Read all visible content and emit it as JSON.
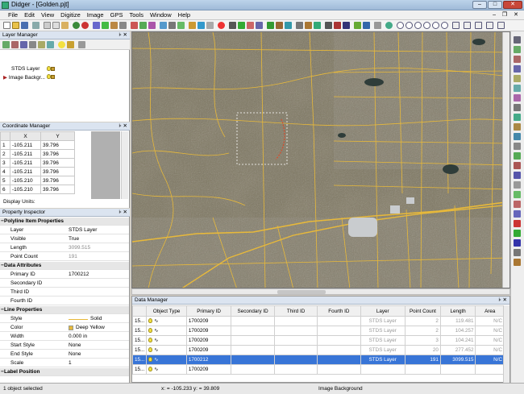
{
  "window": {
    "title": "Didger - [Golden.pjt]",
    "min": "–",
    "max": "□",
    "close": "✕"
  },
  "menu": [
    "File",
    "Edit",
    "View",
    "Digitize",
    "Image",
    "GPS",
    "Tools",
    "Window",
    "Help"
  ],
  "layer_manager": {
    "title": "Layer Manager",
    "layers": [
      {
        "name": "STDS Layer"
      },
      {
        "name": "Image Backgr..."
      }
    ]
  },
  "coordinate_manager": {
    "title": "Coordinate Manager",
    "headers": [
      "X",
      "Y"
    ],
    "rows": [
      [
        "1",
        "-105.211",
        "39.796"
      ],
      [
        "2",
        "-105.211",
        "39.796"
      ],
      [
        "3",
        "-105.211",
        "39.796"
      ],
      [
        "4",
        "-105.211",
        "39.796"
      ],
      [
        "5",
        "-105.210",
        "39.796"
      ],
      [
        "6",
        "-105.210",
        "39.796"
      ]
    ],
    "display_units": "Display Units:"
  },
  "property_inspector": {
    "title": "Property Inspector",
    "rows": [
      {
        "type": "section",
        "label": "Polyline Item Properties"
      },
      {
        "label": "Layer",
        "value": "STDS Layer"
      },
      {
        "label": "Visible",
        "value": "True"
      },
      {
        "label": "Length",
        "value": "3099.515",
        "grey": true
      },
      {
        "label": "Point Count",
        "value": "191",
        "grey": true
      },
      {
        "type": "section",
        "label": "Data Attributes"
      },
      {
        "label": "Primary ID",
        "value": "1700212"
      },
      {
        "label": "Secondary ID",
        "value": ""
      },
      {
        "label": "Third ID",
        "value": ""
      },
      {
        "label": "Fourth ID",
        "value": ""
      },
      {
        "type": "section",
        "label": "Line Properties"
      },
      {
        "label": "Style",
        "value": "Solid"
      },
      {
        "label": "Color",
        "value": "Deep Yellow"
      },
      {
        "label": "Width",
        "value": "0.000 in"
      },
      {
        "label": "Start Style",
        "value": "None"
      },
      {
        "label": "End Style",
        "value": "None"
      },
      {
        "label": "Scale",
        "value": "1"
      },
      {
        "type": "section",
        "label": "Label Position"
      }
    ]
  },
  "data_manager": {
    "title": "Data Manager",
    "headers": [
      "",
      "Object Type",
      "Primary ID",
      "Secondary ID",
      "Third ID",
      "Fourth ID",
      "Layer",
      "Point Count",
      "Length",
      "Area"
    ],
    "rows": [
      [
        "15...",
        "",
        "1700209",
        "",
        "",
        "",
        "STDS Layer",
        "2",
        "119.481",
        "N/C"
      ],
      [
        "15...",
        "",
        "1700209",
        "",
        "",
        "",
        "STDS Layer",
        "2",
        "104.257",
        "N/C"
      ],
      [
        "15...",
        "",
        "1700209",
        "",
        "",
        "",
        "STDS Layer",
        "3",
        "104.241",
        "N/C"
      ],
      [
        "15...",
        "",
        "1700209",
        "",
        "",
        "",
        "STDS Layer",
        "20",
        "277.452",
        "N/C"
      ],
      [
        "15...",
        "",
        "1700212",
        "",
        "",
        "",
        "STDS Layer",
        "191",
        "3099.515",
        "N/C"
      ],
      [
        "15...",
        "",
        "1700209",
        "",
        "",
        "",
        "",
        "",
        "",
        ""
      ]
    ],
    "selected_row": 4
  },
  "status": {
    "left": "1 object selected",
    "coords": "x: = -105.233 y: = 39.809",
    "layer": "Image Background"
  },
  "colors": {
    "road": "#e8b93a",
    "selection": "#3875d7",
    "accent_line": "#d94a2a"
  }
}
